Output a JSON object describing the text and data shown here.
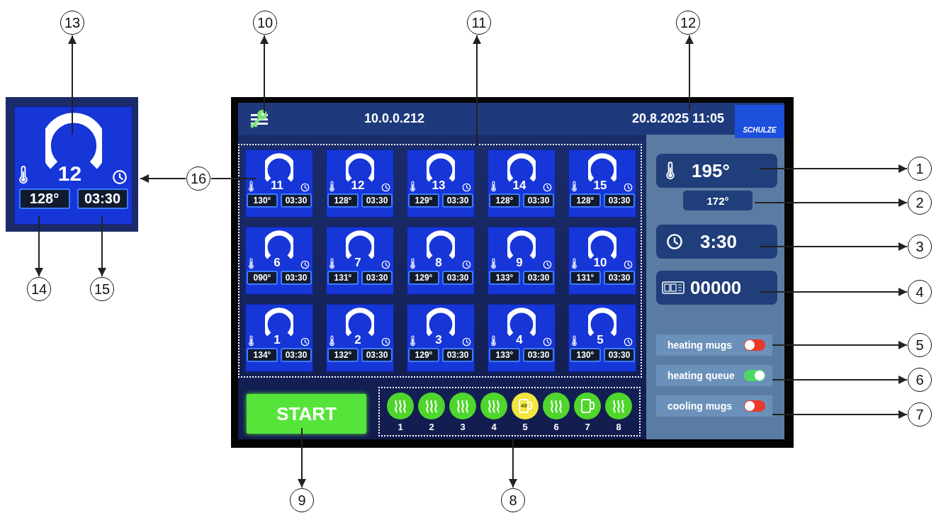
{
  "detail_tile": {
    "number": "12",
    "temperature": "128°",
    "time": "03:30"
  },
  "header": {
    "ip_address": "10.0.0.212",
    "datetime": "20.8.2025 11:05",
    "logo": "SCHULZE"
  },
  "tiles": [
    {
      "number": "11",
      "temperature": "130°",
      "time": "03:30"
    },
    {
      "number": "12",
      "temperature": "128°",
      "time": "03:30"
    },
    {
      "number": "13",
      "temperature": "129°",
      "time": "03:30"
    },
    {
      "number": "14",
      "temperature": "128°",
      "time": "03:30"
    },
    {
      "number": "15",
      "temperature": "128°",
      "time": "03:30"
    },
    {
      "number": "6",
      "temperature": "090°",
      "time": "03:30"
    },
    {
      "number": "7",
      "temperature": "131°",
      "time": "03:30"
    },
    {
      "number": "8",
      "temperature": "129°",
      "time": "03:30"
    },
    {
      "number": "9",
      "temperature": "133°",
      "time": "03:30"
    },
    {
      "number": "10",
      "temperature": "131°",
      "time": "03:30"
    },
    {
      "number": "1",
      "temperature": "134°",
      "time": "03:30"
    },
    {
      "number": "2",
      "temperature": "132°",
      "time": "03:30"
    },
    {
      "number": "3",
      "temperature": "129°",
      "time": "03:30"
    },
    {
      "number": "4",
      "temperature": "133°",
      "time": "03:30"
    },
    {
      "number": "5",
      "temperature": "130°",
      "time": "03:30"
    }
  ],
  "side_panel": {
    "set_temperature": "195°",
    "actual_temperature": "172°",
    "time": "3:30",
    "counter": "00000",
    "toggles": [
      {
        "label": "heating mugs",
        "on": false
      },
      {
        "label": "heating queue",
        "on": true
      },
      {
        "label": "cooling mugs",
        "on": false
      }
    ]
  },
  "start_button": "START",
  "mug_slots": [
    {
      "number": "1",
      "kind": "steam",
      "color": "#4fd62c"
    },
    {
      "number": "2",
      "kind": "steam",
      "color": "#4fd62c"
    },
    {
      "number": "3",
      "kind": "steam",
      "color": "#4fd62c"
    },
    {
      "number": "4",
      "kind": "steam",
      "color": "#4fd62c"
    },
    {
      "number": "5",
      "kind": "mug",
      "color": "#f2e640",
      "label": "49"
    },
    {
      "number": "6",
      "kind": "steam",
      "color": "#4fd62c"
    },
    {
      "number": "7",
      "kind": "mug",
      "color": "#4fd62c"
    },
    {
      "number": "8",
      "kind": "steam",
      "color": "#4fd62c"
    }
  ],
  "callouts": [
    "13",
    "10",
    "11",
    "12",
    "1",
    "16",
    "2",
    "3",
    "14",
    "15",
    "4",
    "5",
    "6",
    "7",
    "9",
    "8"
  ]
}
